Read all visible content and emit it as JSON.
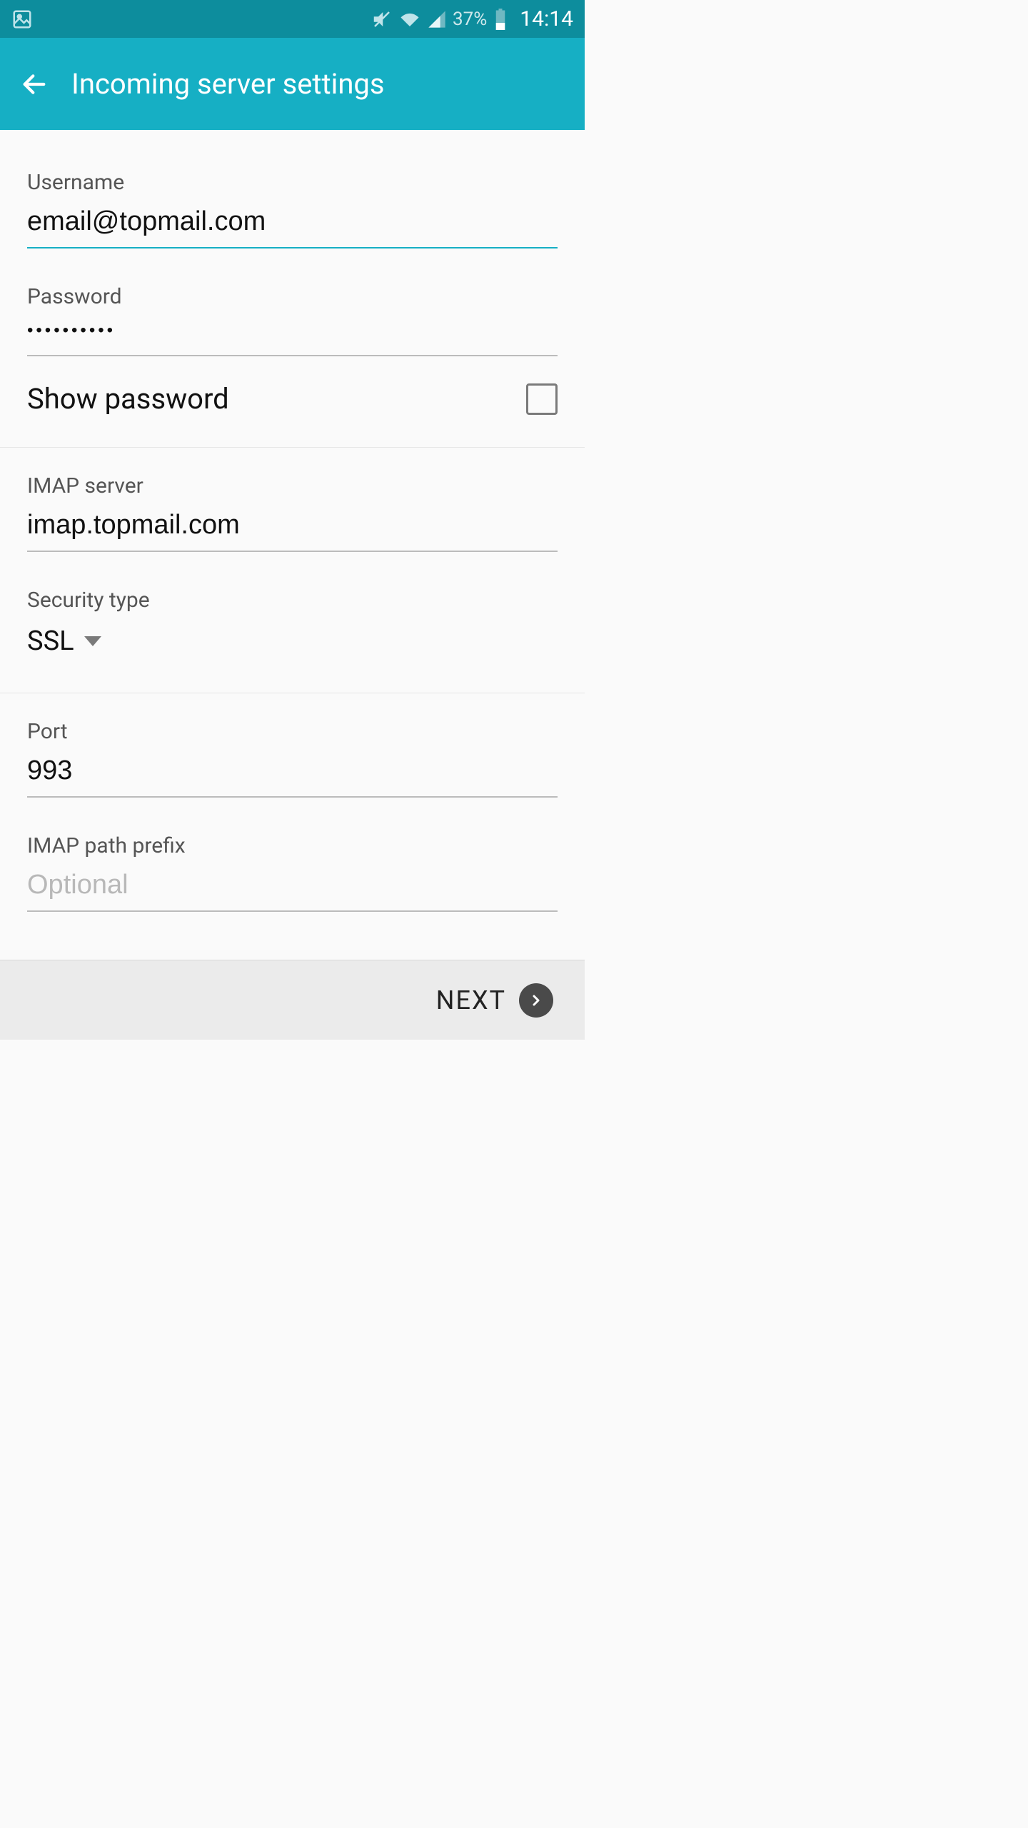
{
  "status": {
    "battery_pct": "37%",
    "clock": "14:14"
  },
  "appbar": {
    "title": "Incoming server settings"
  },
  "form": {
    "username": {
      "label": "Username",
      "value": "email@topmail.com"
    },
    "password": {
      "label": "Password",
      "value": "••••••••••"
    },
    "show_password": {
      "label": "Show password",
      "checked": false
    },
    "imap_server": {
      "label": "IMAP server",
      "value": "imap.topmail.com"
    },
    "security_type": {
      "label": "Security type",
      "value": "SSL"
    },
    "port": {
      "label": "Port",
      "value": "993"
    },
    "imap_path_prefix": {
      "label": "IMAP path prefix",
      "value": "",
      "placeholder": "Optional"
    }
  },
  "footer": {
    "next_label": "NEXT"
  }
}
